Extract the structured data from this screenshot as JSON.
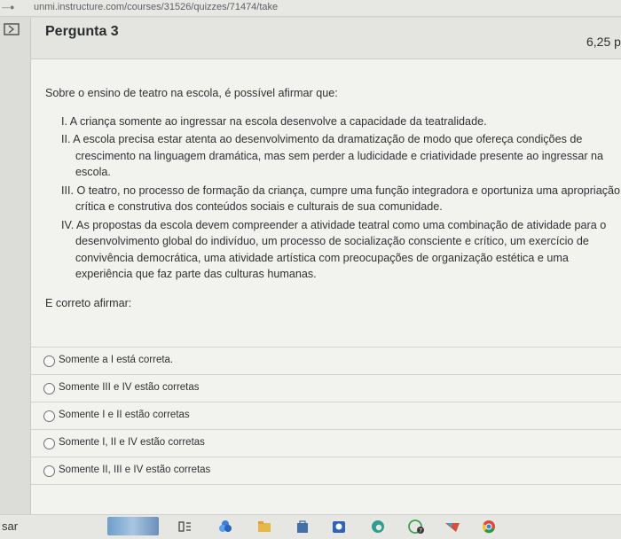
{
  "browser": {
    "url": "unmi.instructure.com/courses/31526/quizzes/71474/take"
  },
  "question": {
    "title": "Pergunta 3",
    "points": "6,25 p",
    "stem": "Sobre o ensino de teatro na escola, é possível afirmar que:",
    "statements": [
      "I. A criança somente ao ingressar na escola desenvolve a capacidade da teatralidade.",
      "II. A escola precisa estar atenta ao desenvolvimento da dramatização de modo que ofereça condições de crescimento na linguagem dramática, mas sem perder a ludicidade e criatividade presente ao ingressar na escola.",
      "III. O teatro, no processo de formação da criança, cumpre uma função integradora e oportuniza uma apropriação crítica e construtiva dos conteúdos sociais e culturais de sua comunidade.",
      "IV. As propostas da escola devem compreender a atividade teatral como uma combinação de atividade para o desenvolvimento global do indivíduo, um processo de socialização consciente e crítico, um exercício de convivência democrática, uma atividade artística com preocupações de organização estética e uma experiência que faz parte das culturas humanas."
    ],
    "prompt": "E correto afirmar:",
    "answers": [
      "Somente a I está correta.",
      "Somente III e IV estão corretas",
      "Somente I e II estão corretas",
      "Somente I, II e IV estão corretas",
      "Somente II, III e IV estão corretas"
    ]
  },
  "taskbar": {
    "search_text": "sar"
  }
}
